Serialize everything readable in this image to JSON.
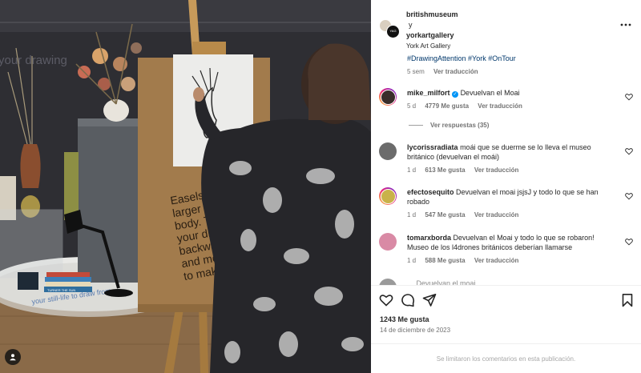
{
  "photo": {
    "canvas_text_top": "your drawing",
    "board_text": [
      "Easels",
      "larger s",
      "body. To",
      "your drav",
      "backwards",
      "and move it f",
      "to make your m"
    ],
    "base_text": "your still-life to draw from",
    "book_text": "TURNER THE SUN"
  },
  "post": {
    "author1": "britishmuseum",
    "conjunction": "y",
    "author2": "yorkartgallery",
    "location": "York Art Gallery",
    "hashtags": "#DrawingAttention #York #OnTour",
    "caption_age": "5 sem",
    "see_translation": "Ver traducción"
  },
  "comments": [
    {
      "user": "mike_milfort",
      "verified": true,
      "text": "Devuelvan el Moai",
      "age": "5 d",
      "likes": "4779 Me gusta",
      "translate": "Ver traducción",
      "ring": true,
      "avatar_color": "#3a2d2a"
    },
    {
      "user": "lycorissradiata",
      "verified": false,
      "text": "moái que se duerme se lo lleva el museo británico (devuelvan el moái)",
      "age": "1 d",
      "likes": "613 Me gusta",
      "translate": "Ver traducción",
      "ring": false,
      "avatar_color": "#6b6b6b"
    },
    {
      "user": "efectosequito",
      "verified": false,
      "text": "Devuelvan el moai jsjsJ y todo lo que se han robado",
      "age": "1 d",
      "likes": "547 Me gusta",
      "translate": "Ver traducción",
      "ring": true,
      "avatar_color": "#c9b24a"
    },
    {
      "user": "tomarxborda",
      "verified": false,
      "text": "Devuelvan el Moai y todo lo que se robaron! Museo de los l4drones británicos deberían llamarse",
      "age": "1 d",
      "likes": "588 Me gusta",
      "translate": "Ver traducción",
      "ring": false,
      "avatar_color": "#d98aa5"
    }
  ],
  "view_replies": "Ver respuestas (35)",
  "partial_next": "… Devuelvan el moai",
  "actions": {
    "likes": "1243 Me gusta",
    "date": "14 de diciembre de 2023",
    "comments_limited": "Se limitaron los comentarios en esta publicación."
  },
  "icons": [
    "more-icon",
    "heart-icon",
    "comment-icon",
    "share-icon",
    "bookmark-icon",
    "user-tag-icon"
  ]
}
